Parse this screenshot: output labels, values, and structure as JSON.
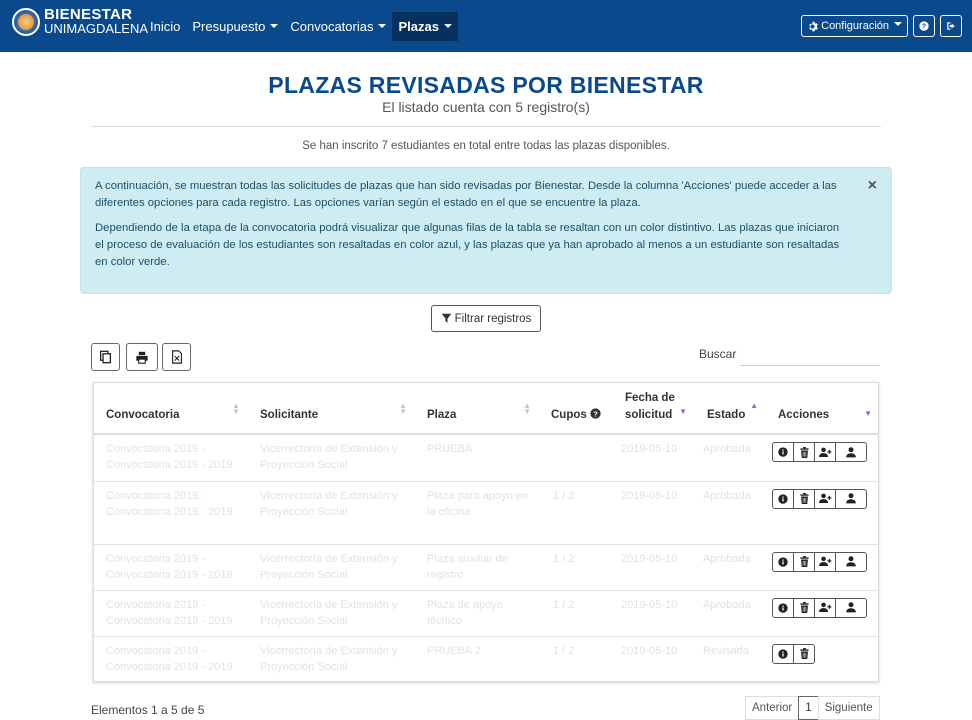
{
  "brand": {
    "line1": "BIENESTAR",
    "line2": "UNIMAGDALENA"
  },
  "nav": {
    "items": [
      {
        "label": "Inicio",
        "dropdown": false,
        "active": false
      },
      {
        "label": "Presupuesto",
        "dropdown": true,
        "active": false
      },
      {
        "label": "Convocatorias",
        "dropdown": true,
        "active": false
      },
      {
        "label": "Plazas",
        "dropdown": true,
        "active": true
      }
    ],
    "config_label": "Configuración"
  },
  "page": {
    "title": "PLAZAS REVISADAS POR BIENESTAR",
    "subtitle": "El listado cuenta con 5 registro(s)",
    "total_text": "Se han inscrito 7 estudiantes en total entre todas las plazas disponibles."
  },
  "alert": {
    "p1": "A continuación, se muestran todas las solicitudes de plazas que han sido revisadas por Bienestar. Desde la columna 'Acciones' puede acceder a las diferentes opciones para cada registro. Las opciones varían según el estado en el que se encuentre la plaza.",
    "p2": "Dependiendo de la etapa de la convocatoria podrá visualizar que algunas filas de la tabla se resaltan con un color distintivo. Las plazas que iniciaron el proceso de evaluación de los estudiantes son resaltadas en color azul, y las plazas que ya han aprobado al menos a un estudiante son resaltadas en color verde.",
    "close": "×"
  },
  "filter_label": "Filtrar registros",
  "search_label": "Buscar",
  "table": {
    "headers": {
      "convocatoria": "Convocatoria",
      "solicitante": "Solicitante",
      "plaza": "Plaza",
      "cupos": "Cupos",
      "fecha_1": "Fecha de",
      "fecha_2": "solicitud",
      "estado": "Estado",
      "acciones": "Acciones"
    },
    "rows": [
      {
        "convocatoria": "Convocatoria 2019 - Convocatoria 2019 - 2019",
        "solicitante": "Vicerrectoría de Extensión y Proyección Social",
        "plaza": "PRUEBA",
        "cupos": "",
        "fecha": "2019-05-10",
        "estado": "Aprobada",
        "actions": 4
      },
      {
        "convocatoria": "Convocatoria 2019 - Convocatoria 2019 - 2019",
        "solicitante": "Vicerrectoría de Extensión y Proyección Social",
        "plaza": "Plaza para apoyo en la oficina",
        "cupos": "1 / 2",
        "fecha": "2019-05-10",
        "estado": "Aprobada",
        "actions": 4
      },
      {
        "convocatoria": "Convocatoria 2019 - Convocatoria 2019 - 2019",
        "solicitante": "Vicerrectoría de Extensión y Proyección Social",
        "plaza": "Plaza auxiliar de registro",
        "cupos": "1 / 2",
        "fecha": "2019-05-10",
        "estado": "Aprobada",
        "actions": 4
      },
      {
        "convocatoria": "Convocatoria 2019 - Convocatoria 2019 - 2019",
        "solicitante": "Vicerrectoría de Extensión y Proyección Social",
        "plaza": "Plaza de apoyo técnico",
        "cupos": "1 / 2",
        "fecha": "2019-05-10",
        "estado": "Aprobada",
        "actions": 4
      },
      {
        "convocatoria": "Convocatoria 2019 - Convocatoria 2019 - 2019",
        "solicitante": "Vicerrectoría de Extensión y Proyección Social",
        "plaza": "PRUEBA 2",
        "cupos": "1 / 2",
        "fecha": "2019-05-10",
        "estado": "Revisada",
        "actions": 2
      }
    ]
  },
  "footer": {
    "info": "Elementos 1 a 5 de 5",
    "prev": "Anterior",
    "page": "1",
    "next": "Siguiente"
  }
}
